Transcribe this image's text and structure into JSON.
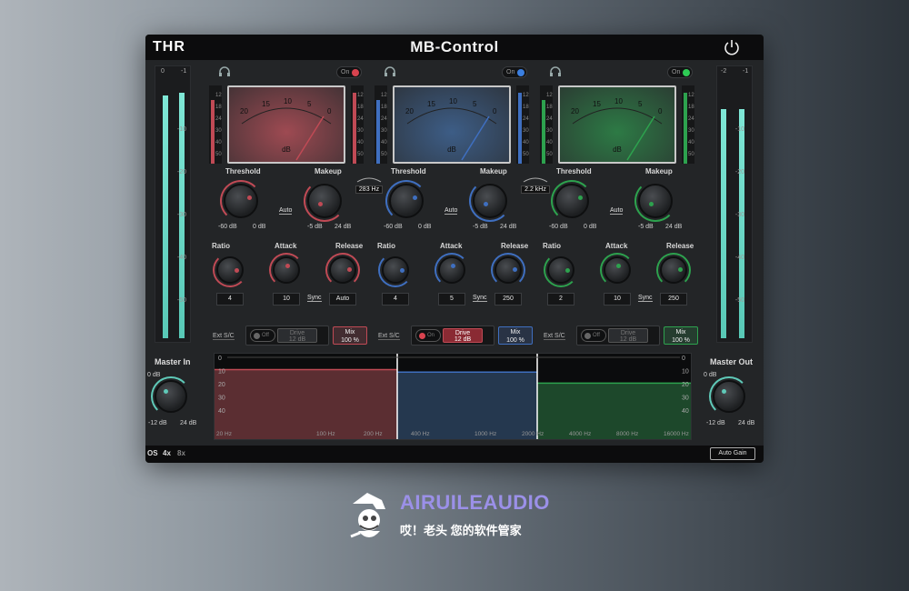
{
  "window": {
    "logo": "THR",
    "title": "MB-Control"
  },
  "meter_in": {
    "hdr_left": "0",
    "hdr_right": "-1",
    "ticks": [
      "-10",
      "-20",
      "-30",
      "-40",
      "-50"
    ],
    "level_left": 0.92,
    "level_right": 0.93
  },
  "meter_out": {
    "hdr_left": "-2",
    "hdr_right": "-1",
    "ticks": [
      "-10",
      "-20",
      "-30",
      "-40",
      "-50"
    ],
    "level_left": 0.87,
    "level_right": 0.87
  },
  "crossovers": [
    "283 Hz",
    "2.2 kHz"
  ],
  "bands": [
    {
      "color": "#c04a55",
      "vu_bg": "#9e4a52",
      "power_on": true,
      "on_label": "On",
      "on_dot": "#d8434f",
      "vu_scale": [
        "20",
        "15",
        "10",
        "5",
        "0"
      ],
      "vu_unit": "dB",
      "side_scale": [
        "12",
        "18",
        "24",
        "30",
        "40",
        "50"
      ],
      "threshold_label": "Threshold",
      "threshold_min": "-60 dB",
      "threshold_max": "0 dB",
      "makeup_label": "Makeup",
      "makeup_auto": "Auto",
      "makeup_min": "-5 dB",
      "makeup_max": "24 dB",
      "ratio_label": "Ratio",
      "ratio_value": "4",
      "attack_label": "Attack",
      "attack_value": "10",
      "release_label": "Release",
      "release_value": "Auto",
      "sync_label": "Sync",
      "ext_sc": "Ext S/C",
      "ext_toggle": "Off",
      "ext_dot": "#666",
      "drive_label": "Drive",
      "drive_value": "12 dB",
      "drive_active": false,
      "mix_label": "Mix",
      "mix_value": "100 %"
    },
    {
      "color": "#3f6fc0",
      "vu_bg": "#3d5d86",
      "power_on": true,
      "on_label": "On",
      "on_dot": "#3b7fe0",
      "vu_scale": [
        "20",
        "15",
        "10",
        "5",
        "0"
      ],
      "vu_unit": "dB",
      "side_scale": [
        "12",
        "18",
        "24",
        "30",
        "40",
        "50"
      ],
      "threshold_label": "Threshold",
      "threshold_min": "-60 dB",
      "threshold_max": "0 dB",
      "makeup_label": "Makeup",
      "makeup_auto": "Auto",
      "makeup_min": "-5 dB",
      "makeup_max": "24 dB",
      "ratio_label": "Ratio",
      "ratio_value": "4",
      "attack_label": "Attack",
      "attack_value": "5",
      "release_label": "Release",
      "release_value": "250",
      "sync_label": "Sync",
      "ext_sc": "Ext S/C",
      "ext_toggle": "On",
      "ext_dot": "#d8434f",
      "drive_label": "Drive",
      "drive_value": "12 dB",
      "drive_active": true,
      "mix_label": "Mix",
      "mix_value": "100 %"
    },
    {
      "color": "#2da24e",
      "vu_bg": "#2d7a45",
      "power_on": true,
      "on_label": "On",
      "on_dot": "#2ecc55",
      "vu_scale": [
        "20",
        "15",
        "10",
        "5",
        "0"
      ],
      "vu_unit": "dB",
      "side_scale": [
        "12",
        "18",
        "24",
        "30",
        "40",
        "50"
      ],
      "threshold_label": "Threshold",
      "threshold_min": "-60 dB",
      "threshold_max": "0 dB",
      "makeup_label": "Makeup",
      "makeup_auto": "Auto",
      "makeup_min": "-5 dB",
      "makeup_max": "24 dB",
      "ratio_label": "Ratio",
      "ratio_value": "2",
      "attack_label": "Attack",
      "attack_value": "10",
      "release_label": "Release",
      "release_value": "250",
      "sync_label": "Sync",
      "ext_sc": "Ext S/C",
      "ext_toggle": "Off",
      "ext_dot": "#666",
      "drive_label": "Drive",
      "drive_value": "12 dB",
      "drive_active": false,
      "mix_label": "Mix",
      "mix_value": "100 %"
    }
  ],
  "master_in": {
    "label": "Master In",
    "value": "0 dB",
    "min": "-12 dB",
    "max": "24 dB"
  },
  "master_out": {
    "label": "Master Out",
    "value": "0 dB",
    "min": "-12 dB",
    "max": "24 dB"
  },
  "graph": {
    "left_scale": [
      "0",
      "10",
      "20",
      "30",
      "40"
    ],
    "right_scale": [
      "0",
      "10",
      "20",
      "30",
      "40"
    ],
    "freq_labels": [
      "20 Hz",
      "100 Hz",
      "200 Hz",
      "400 Hz",
      "1000 Hz",
      "2000 Hz",
      "4000 Hz",
      "8000 Hz",
      "16000 Hz"
    ],
    "band_levels_db": [
      10,
      12,
      21
    ]
  },
  "footer": {
    "os": "OS",
    "x4": "4x",
    "x8": "8x",
    "auto_gain": "Auto Gain"
  },
  "branding": {
    "name": "AIRUILEAUDIO",
    "tagline": "哎！老头 您的软件管家"
  }
}
